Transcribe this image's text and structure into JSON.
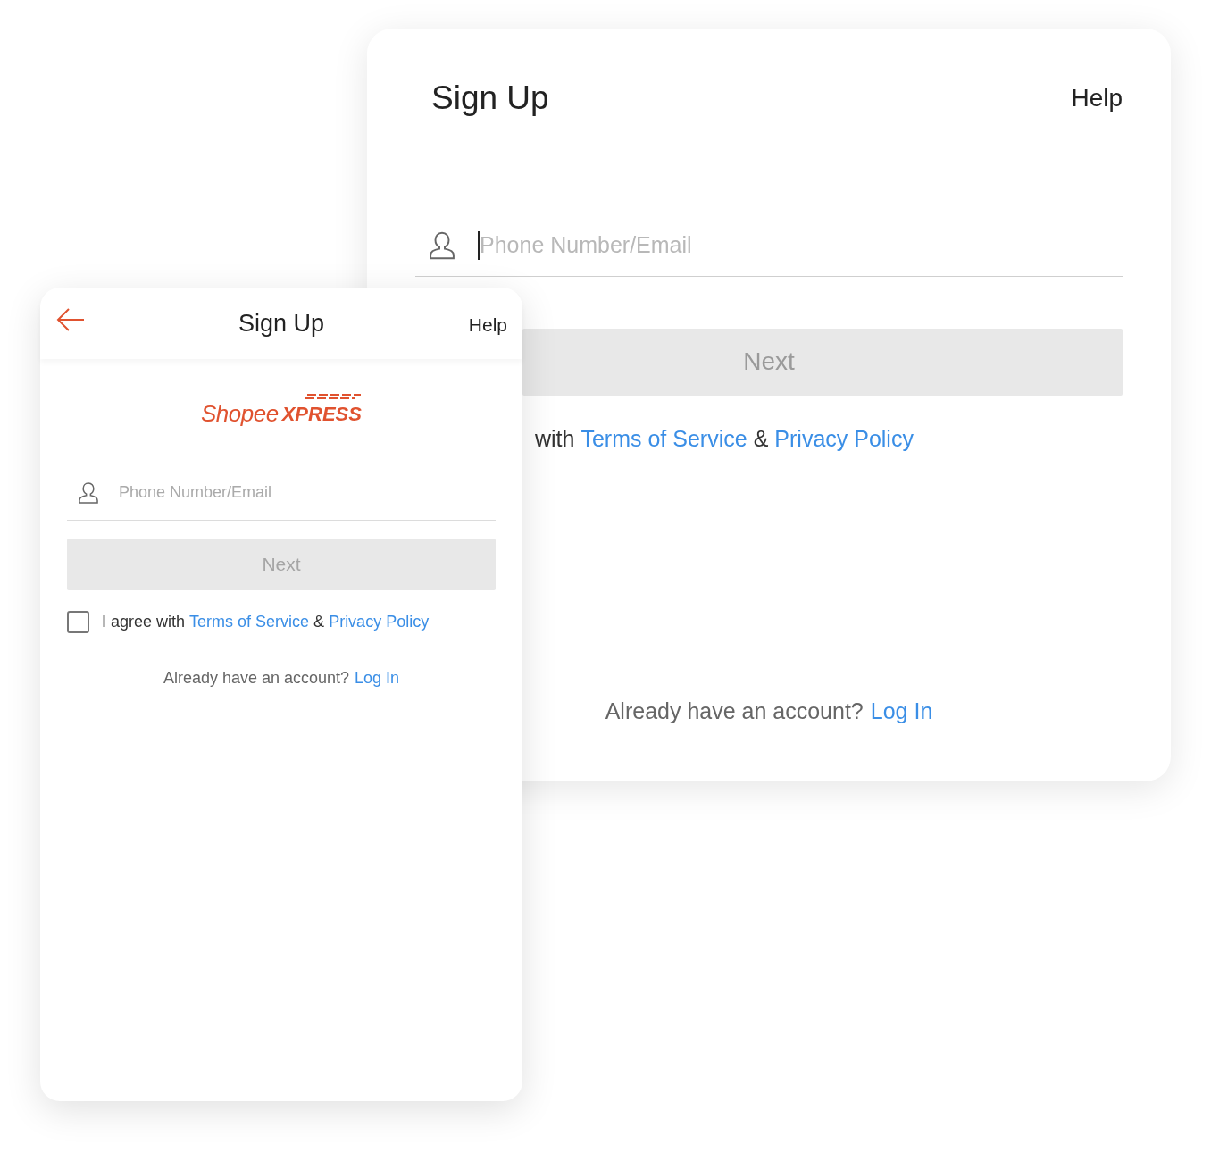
{
  "desktop_card": {
    "title": "Sign Up",
    "help": "Help",
    "field": {
      "placeholder": "Phone Number/Email",
      "focused": true
    },
    "next_button": "Next",
    "agreement": {
      "text": "with",
      "terms": "Terms of Service",
      "and": "&",
      "privacy": "Privacy Policy"
    },
    "login_prompt": {
      "text": "Already have an account?",
      "link": "Log In"
    }
  },
  "mobile_card": {
    "title": "Sign Up",
    "help": "Help",
    "logo": {
      "part_1": "Shopee",
      "part_2": "XPRESS"
    },
    "field": {
      "placeholder": "Phone Number/Email"
    },
    "next_button": "Next",
    "agreement": {
      "checked": false,
      "text": "I agree with",
      "terms": "Terms of Service",
      "and": "&",
      "privacy": "Privacy Policy"
    },
    "login_prompt": {
      "text": "Already have an account?",
      "link": "Log In"
    }
  }
}
